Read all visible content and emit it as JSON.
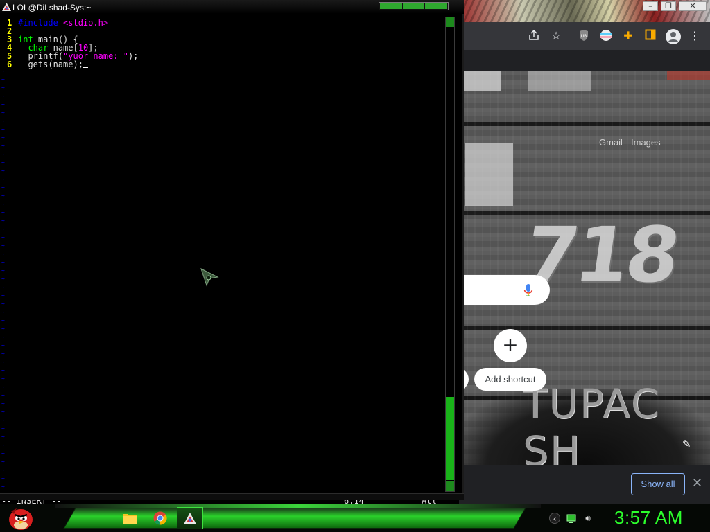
{
  "terminal": {
    "title": "LOL@DiLshad-Sys:~",
    "line_numbers": [
      "1",
      "2",
      "3",
      "4",
      "5",
      "6"
    ],
    "code": {
      "line1": {
        "directive": "#include",
        "header": "<stdio.h>"
      },
      "line3": {
        "type": "int",
        "rest": "main() {"
      },
      "line4": {
        "indent": "  ",
        "type": "char",
        "name": "name[",
        "num": "10",
        "end": "];"
      },
      "line5": {
        "indent": "  ",
        "func": "printf(",
        "str": "\"yuor name: \"",
        "end": ");"
      },
      "line6": {
        "indent": "  ",
        "text": "gets(name);"
      }
    },
    "empty_line_marker": "~",
    "status": {
      "mode": "-- INSERT --",
      "position": "6,14",
      "scroll": "All"
    }
  },
  "browser": {
    "window_controls": [
      "–",
      "❐",
      "✕"
    ],
    "toolbar_icons": [
      "share-icon",
      "star-icon",
      "extension-icon",
      "profile-icon",
      "puzzle-icon",
      "sidebar-icon",
      "account-icon",
      "menu-icon"
    ],
    "ntp": {
      "links": {
        "gmail": "Gmail",
        "images": "Images"
      },
      "wallpaper_number": "718",
      "wallpaper_text": "TUPAC SH",
      "add_shortcut": {
        "icon": "+",
        "label": "Add shortcut"
      }
    },
    "download_bar": {
      "show_all": "Show all",
      "close": "✕"
    }
  },
  "taskbar": {
    "clock": "3:57 AM",
    "apps": [
      "file-explorer",
      "chrome",
      "terminal"
    ]
  },
  "colors": {
    "vim_line_number": "#ffff00",
    "vim_preproc": "#0000ff",
    "vim_string": "#ff00ff",
    "vim_type": "#00ff00",
    "vim_tilde": "#0000ff",
    "accent_green": "#2cff2c",
    "chrome_link": "#8ab4f8"
  }
}
